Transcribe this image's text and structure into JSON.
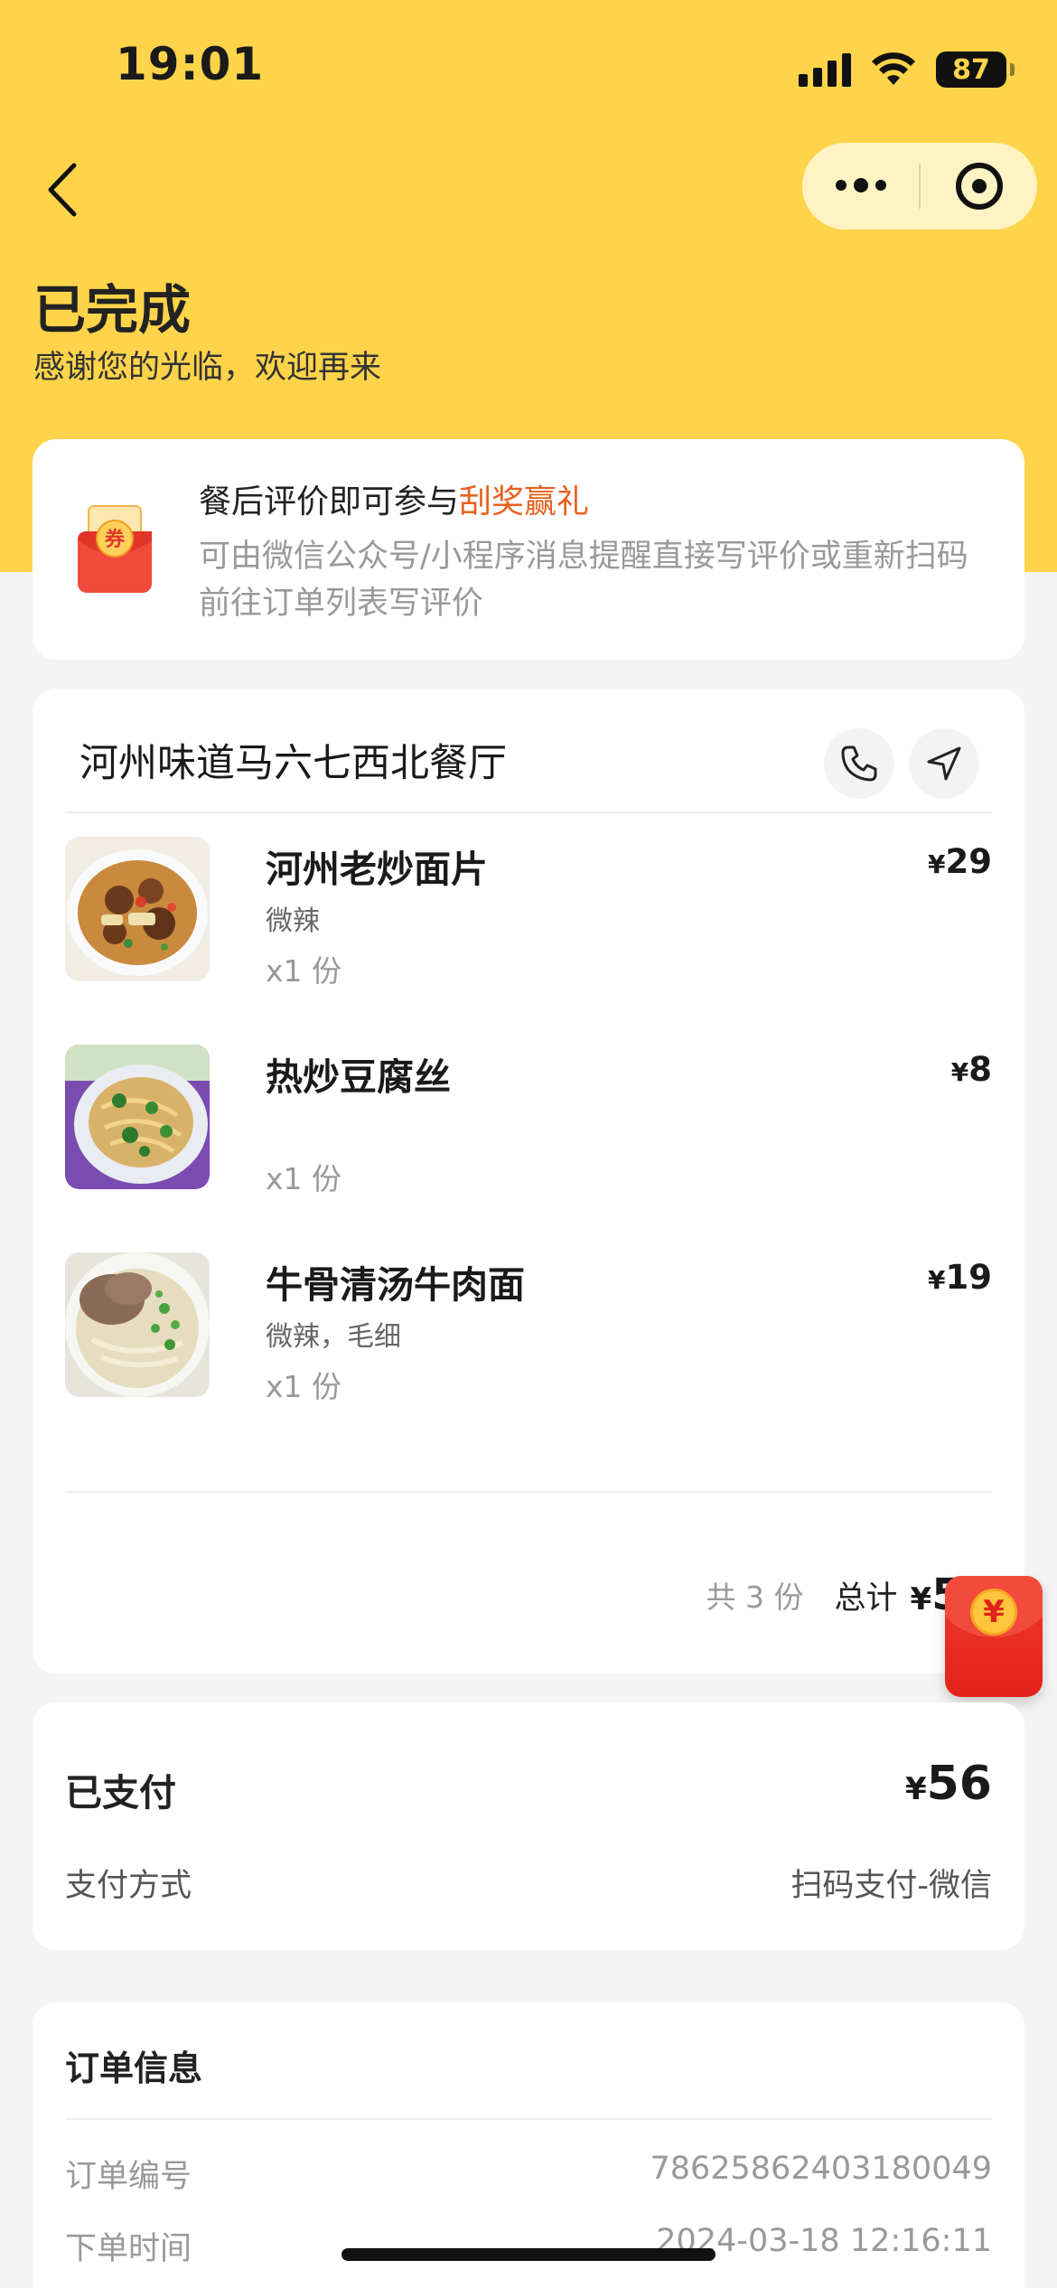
{
  "status_bar": {
    "time": "19:01",
    "battery": "87"
  },
  "header": {
    "title": "已完成",
    "subtitle": "感谢您的光临，欢迎再来"
  },
  "promo": {
    "title_prefix": "餐后评价即可参与",
    "title_highlight": "刮奖赢礼",
    "description": "可由微信公众号/小程序消息提醒直接写评价或重新扫码前往订单列表写评价",
    "icon_text": "券"
  },
  "order": {
    "shop_name": "河州味道马六七西北餐厅",
    "items": [
      {
        "name": "河州老炒面片",
        "spec": "微辣",
        "qty": "x1 份",
        "currency": "¥",
        "price": "29"
      },
      {
        "name": "热炒豆腐丝",
        "spec": "",
        "qty": "x1 份",
        "currency": "¥",
        "price": "8"
      },
      {
        "name": "牛骨清汤牛肉面",
        "spec": "微辣，毛细",
        "qty": "x1 份",
        "currency": "¥",
        "price": "19"
      }
    ],
    "count_text": "共 3 份",
    "total_label": "总计",
    "total_currency": "¥",
    "total_value": "56"
  },
  "floating_envelope": {
    "symbol": "¥"
  },
  "payment": {
    "status": "已支付",
    "currency": "¥",
    "amount": "56",
    "method_label": "支付方式",
    "method_value": "扫码支付-微信"
  },
  "order_info": {
    "title": "订单信息",
    "rows": [
      {
        "label": "订单编号",
        "value": "78625862403180049"
      },
      {
        "label": "下单时间",
        "value": "2024-03-18 12:16:11"
      }
    ]
  },
  "colors": {
    "header_bg": "#FFD44A",
    "accent": "#E8601F",
    "envelope_red": "#E2231B"
  },
  "icons": [
    "back-arrow-icon",
    "more-dots-icon",
    "close-target-icon",
    "coupon-envelope-icon",
    "phone-icon",
    "navigation-icon",
    "red-envelope-icon"
  ]
}
